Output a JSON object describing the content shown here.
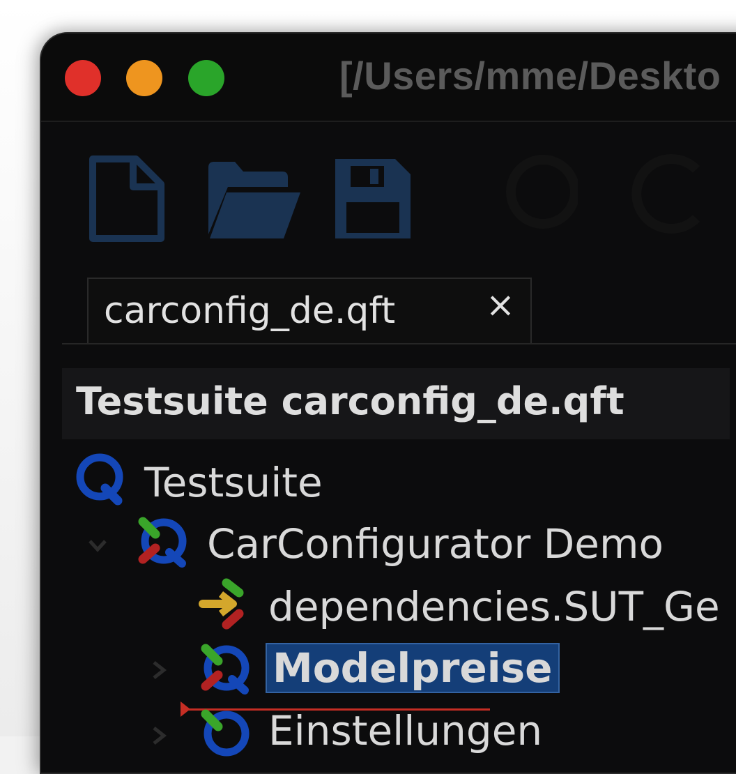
{
  "window": {
    "title": "[/Users/mme/Deskto"
  },
  "toolbar": {
    "buttons": [
      {
        "icon": "new-file-icon"
      },
      {
        "icon": "open-folder-icon"
      },
      {
        "icon": "save-icon"
      }
    ],
    "icon_color": "#1a3352"
  },
  "tabs": [
    {
      "label": "carconfig_de.qft",
      "close": "×"
    }
  ],
  "panel": {
    "title": "Testsuite carconfig_de.qft"
  },
  "tree": {
    "root": {
      "label": "Testsuite",
      "icon": "qftest-suite-icon"
    },
    "children": [
      {
        "label": "CarConfigurator Demo",
        "icon": "qftest-test-set-icon",
        "expanded": true
      },
      {
        "label": "dependencies.SUT_Ge",
        "icon": "dependency-reference-icon"
      },
      {
        "label": "Modelpreise",
        "icon": "qftest-test-case-icon",
        "selected": true
      },
      {
        "label": "Einstellungen",
        "icon": "qftest-test-case-icon"
      }
    ]
  },
  "colors": {
    "selection_bg": "#143e78",
    "drop_marker": "#c62e24",
    "qf_blue": "#1447b8",
    "green": "#3aa52a",
    "red": "#b22222",
    "yellow": "#d4a72c"
  }
}
